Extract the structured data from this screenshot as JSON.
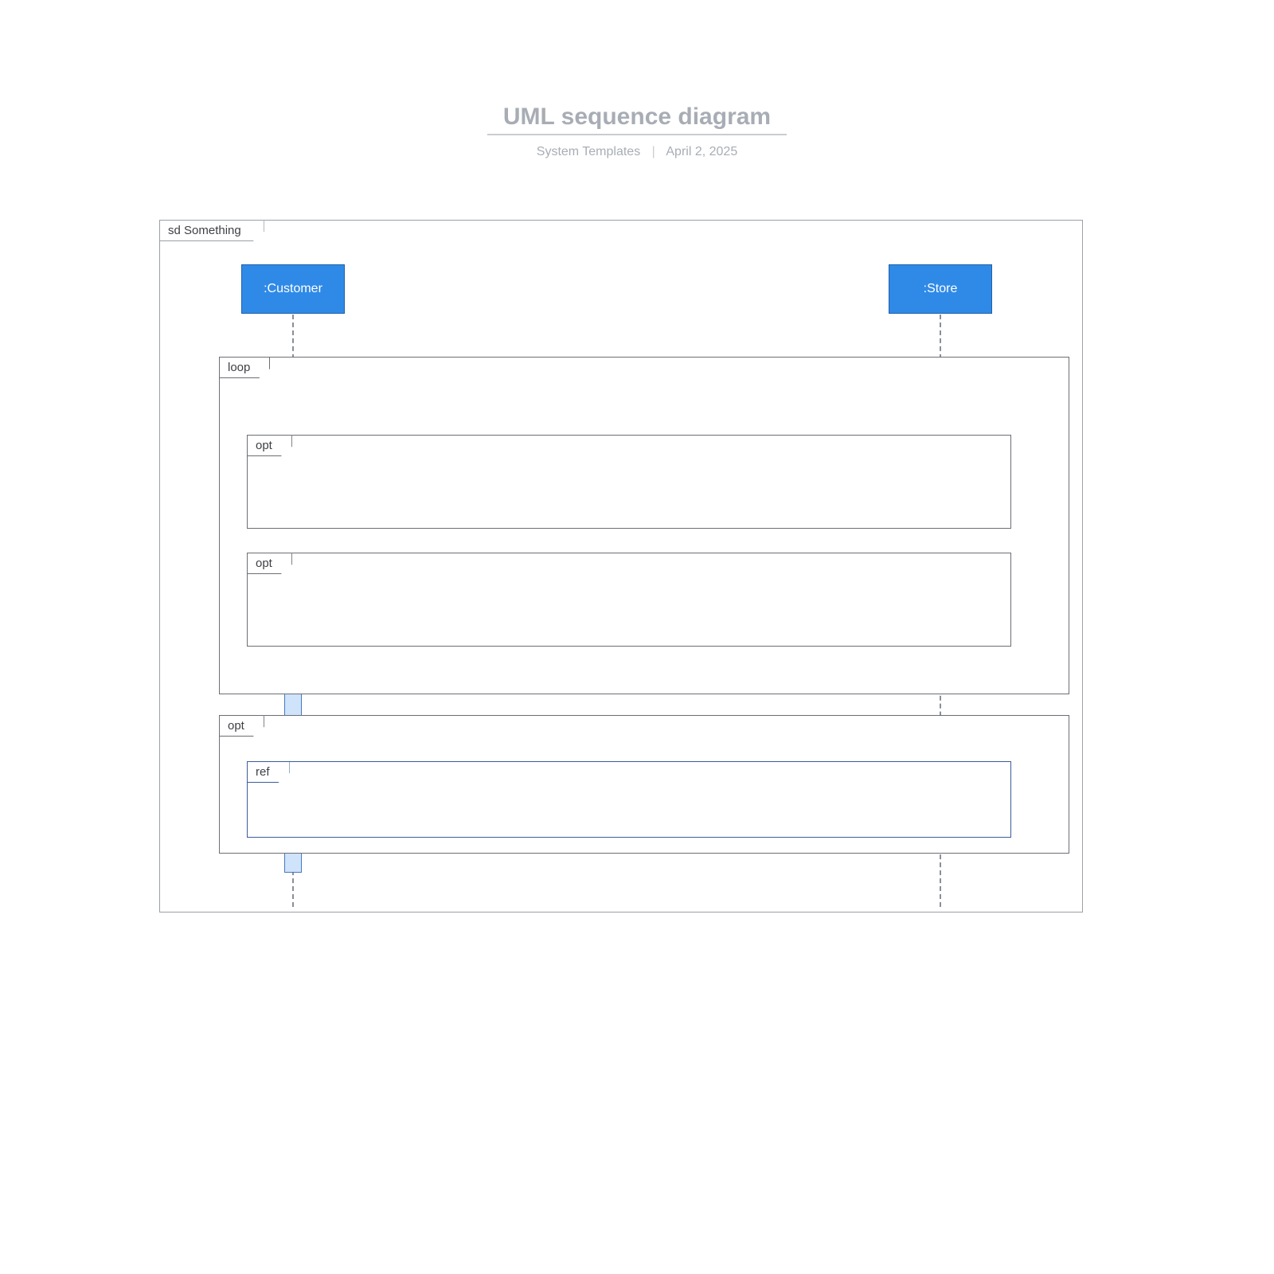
{
  "header": {
    "title": "UML sequence diagram",
    "category": "System Templates",
    "date": "April 2, 2025"
  },
  "diagram": {
    "frame_label": "sd Something",
    "actors": {
      "customer": ":Customer",
      "store": ":Store"
    },
    "fragments": {
      "loop": "loop",
      "opt1": "opt",
      "opt2": "opt",
      "opt3": "opt",
      "ref": "ref"
    }
  }
}
